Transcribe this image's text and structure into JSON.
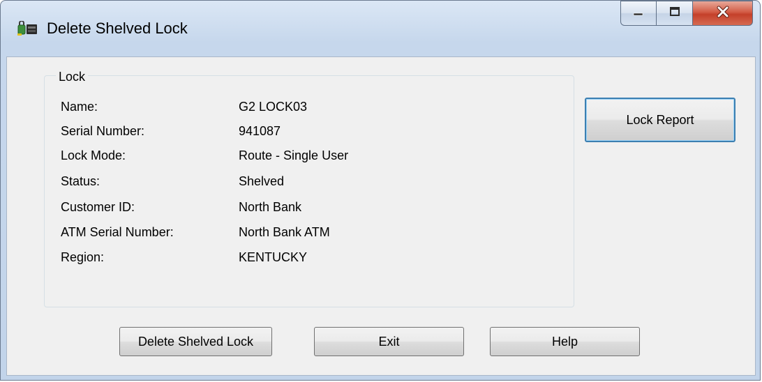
{
  "window": {
    "title": "Delete Shelved Lock",
    "icon": "lock-app-icon",
    "caption_buttons": [
      "minimize-icon",
      "maximize-icon",
      "close-icon"
    ]
  },
  "groupbox": {
    "legend": "Lock"
  },
  "fields": [
    {
      "label": "Name:",
      "value": "G2 LOCK03"
    },
    {
      "label": "Serial Number:",
      "value": "941087"
    },
    {
      "label": "Lock Mode:",
      "value": "Route - Single User"
    },
    {
      "label": "Status:",
      "value": "Shelved"
    },
    {
      "label": "Customer ID:",
      "value": "North Bank"
    },
    {
      "label": "ATM Serial Number:",
      "value": "North Bank ATM"
    },
    {
      "label": "Region:",
      "value": "KENTUCKY"
    }
  ],
  "buttons": {
    "lock_report": "Lock Report",
    "delete": "Delete Shelved Lock",
    "exit": "Exit",
    "help": "Help"
  },
  "colors": {
    "default_button_border": "#3c7fb1",
    "close_button": "#c4402a",
    "title_bar": "#c6d7ec"
  }
}
